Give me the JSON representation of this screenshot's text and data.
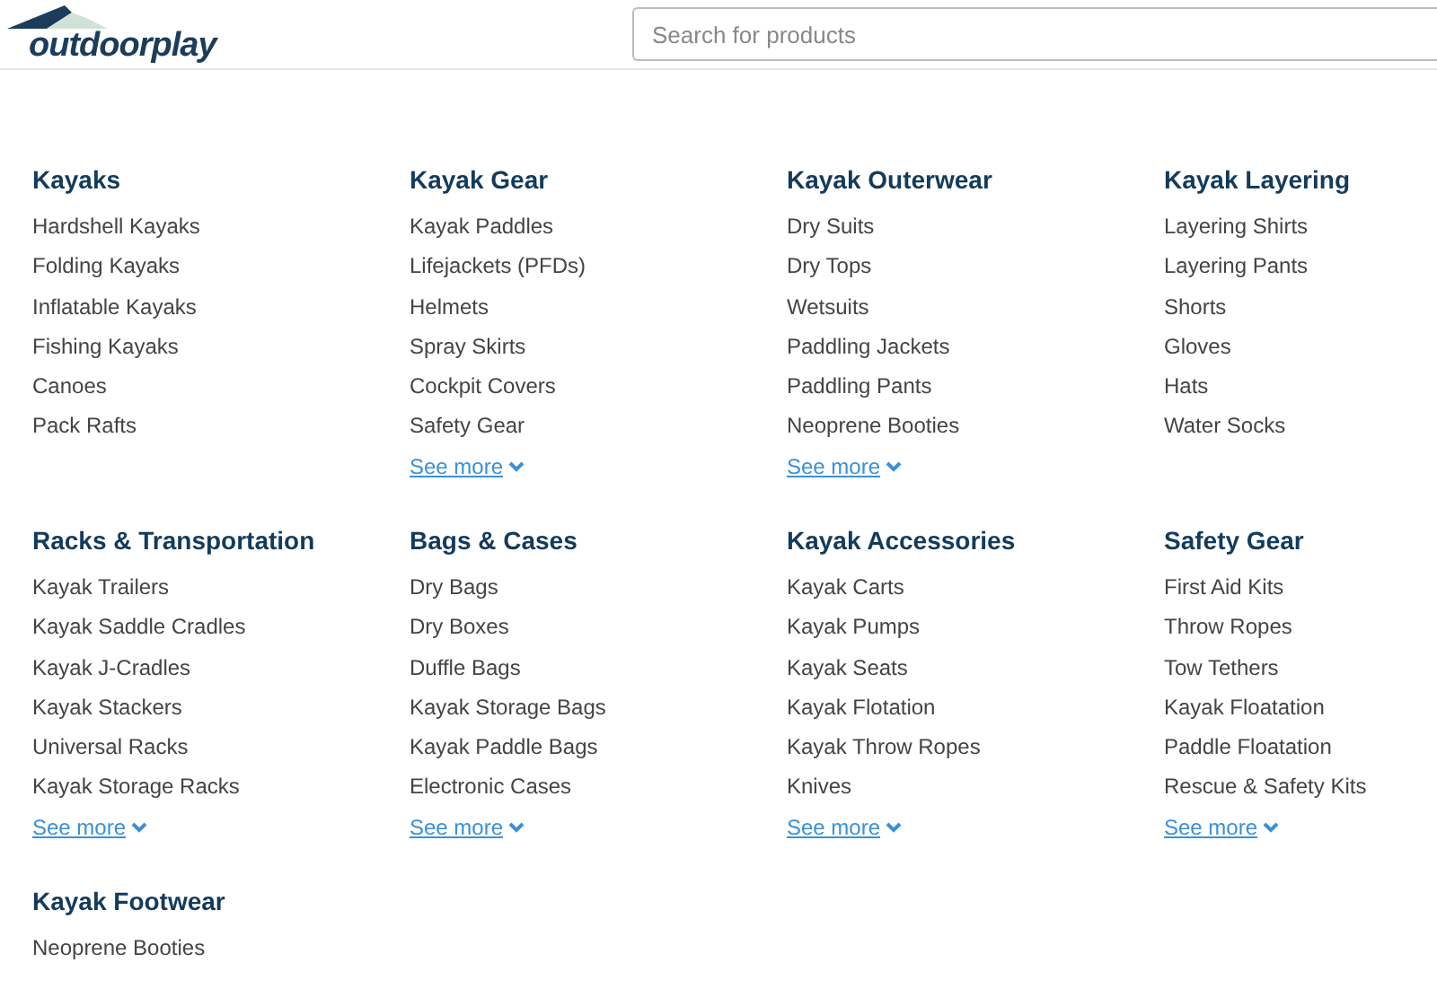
{
  "logo": "outdoorplay",
  "search": {
    "placeholder": "Search for products"
  },
  "categories": [
    {
      "title": "Kayaks",
      "items": [
        "Hardshell Kayaks",
        "Folding Kayaks",
        "Inflatable Kayaks",
        "Fishing Kayaks",
        "Canoes",
        "Pack Rafts"
      ]
    },
    {
      "title": "Kayak Gear",
      "items": [
        "Kayak Paddles",
        "Lifejackets (PFDs)",
        "Helmets",
        "Spray Skirts",
        "Cockpit Covers",
        "Safety Gear"
      ],
      "see_more": "See more"
    },
    {
      "title": "Kayak Outerwear",
      "items": [
        "Dry Suits",
        "Dry Tops",
        "Wetsuits",
        "Paddling Jackets",
        "Paddling Pants",
        "Neoprene Booties"
      ],
      "see_more": "See more"
    },
    {
      "title": "Kayak Layering",
      "items": [
        "Layering Shirts",
        "Layering Pants",
        "Shorts",
        "Gloves",
        "Hats",
        "Water Socks"
      ]
    },
    {
      "title": "Racks & Transportation",
      "items": [
        "Kayak Trailers",
        "Kayak Saddle Cradles",
        "Kayak J-Cradles",
        "Kayak Stackers",
        "Universal Racks",
        "Kayak Storage Racks"
      ],
      "see_more": "See more"
    },
    {
      "title": "Bags & Cases",
      "items": [
        "Dry Bags",
        "Dry Boxes",
        "Duffle Bags",
        "Kayak Storage Bags",
        "Kayak Paddle Bags",
        "Electronic Cases"
      ],
      "see_more": "See more"
    },
    {
      "title": "Kayak Accessories",
      "items": [
        "Kayak Carts",
        "Kayak Pumps",
        "Kayak Seats",
        "Kayak Flotation",
        "Kayak Throw Ropes",
        "Knives"
      ],
      "see_more": "See more"
    },
    {
      "title": "Safety Gear",
      "items": [
        "First Aid Kits",
        "Throw Ropes",
        "Tow Tethers",
        "Kayak Floatation",
        "Paddle Floatation",
        "Rescue & Safety Kits"
      ],
      "see_more": "See more"
    },
    {
      "title": "Kayak Footwear",
      "items": [
        "Neoprene Booties"
      ]
    }
  ]
}
